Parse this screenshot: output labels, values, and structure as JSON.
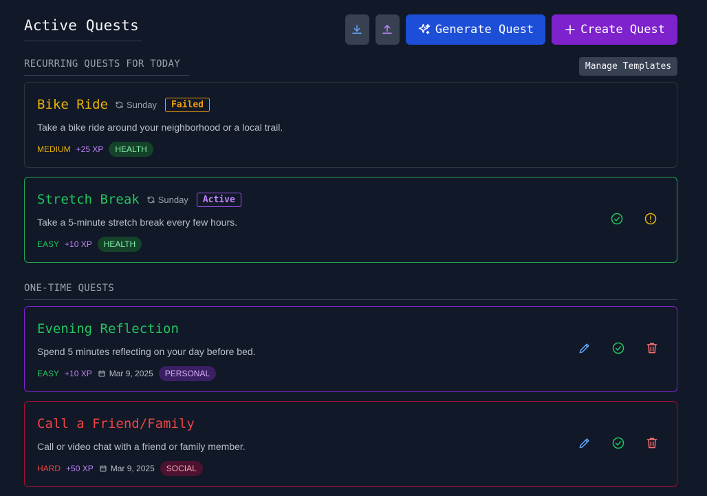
{
  "header": {
    "title": "Active Quests",
    "download_icon": "download-icon",
    "upload_icon": "upload-icon",
    "generate_label": "Generate Quest",
    "create_label": "Create Quest"
  },
  "recurring": {
    "section_label": "RECURRING QUESTS FOR TODAY",
    "manage_label": "Manage Templates",
    "quests": [
      {
        "title": "Bike Ride",
        "repeat": "Sunday",
        "status": "Failed",
        "description": "Take a bike ride around your neighborhood or a local trail.",
        "difficulty": "MEDIUM",
        "xp": "+25 XP",
        "tag": "HEALTH"
      },
      {
        "title": "Stretch Break",
        "repeat": "Sunday",
        "status": "Active",
        "description": "Take a 5-minute stretch break every few hours.",
        "difficulty": "EASY",
        "xp": "+10 XP",
        "tag": "HEALTH"
      }
    ]
  },
  "onetime": {
    "section_label": "ONE-TIME QUESTS",
    "quests": [
      {
        "title": "Evening Reflection",
        "description": "Spend 5 minutes reflecting on your day before bed.",
        "difficulty": "EASY",
        "xp": "+10 XP",
        "date": "Mar 9, 2025",
        "tag": "PERSONAL"
      },
      {
        "title": "Call a Friend/Family",
        "description": "Call or video chat with a friend or family member.",
        "difficulty": "HARD",
        "xp": "+50 XP",
        "date": "Mar 9, 2025",
        "tag": "SOCIAL"
      }
    ]
  },
  "colors": {
    "background": "#111827",
    "generate": "#1d4ed8",
    "create": "#7e22ce",
    "medium": "#eab308",
    "easy": "#22c55e",
    "hard": "#ef4444",
    "xp": "#c084fc",
    "active": "#a855f7"
  }
}
